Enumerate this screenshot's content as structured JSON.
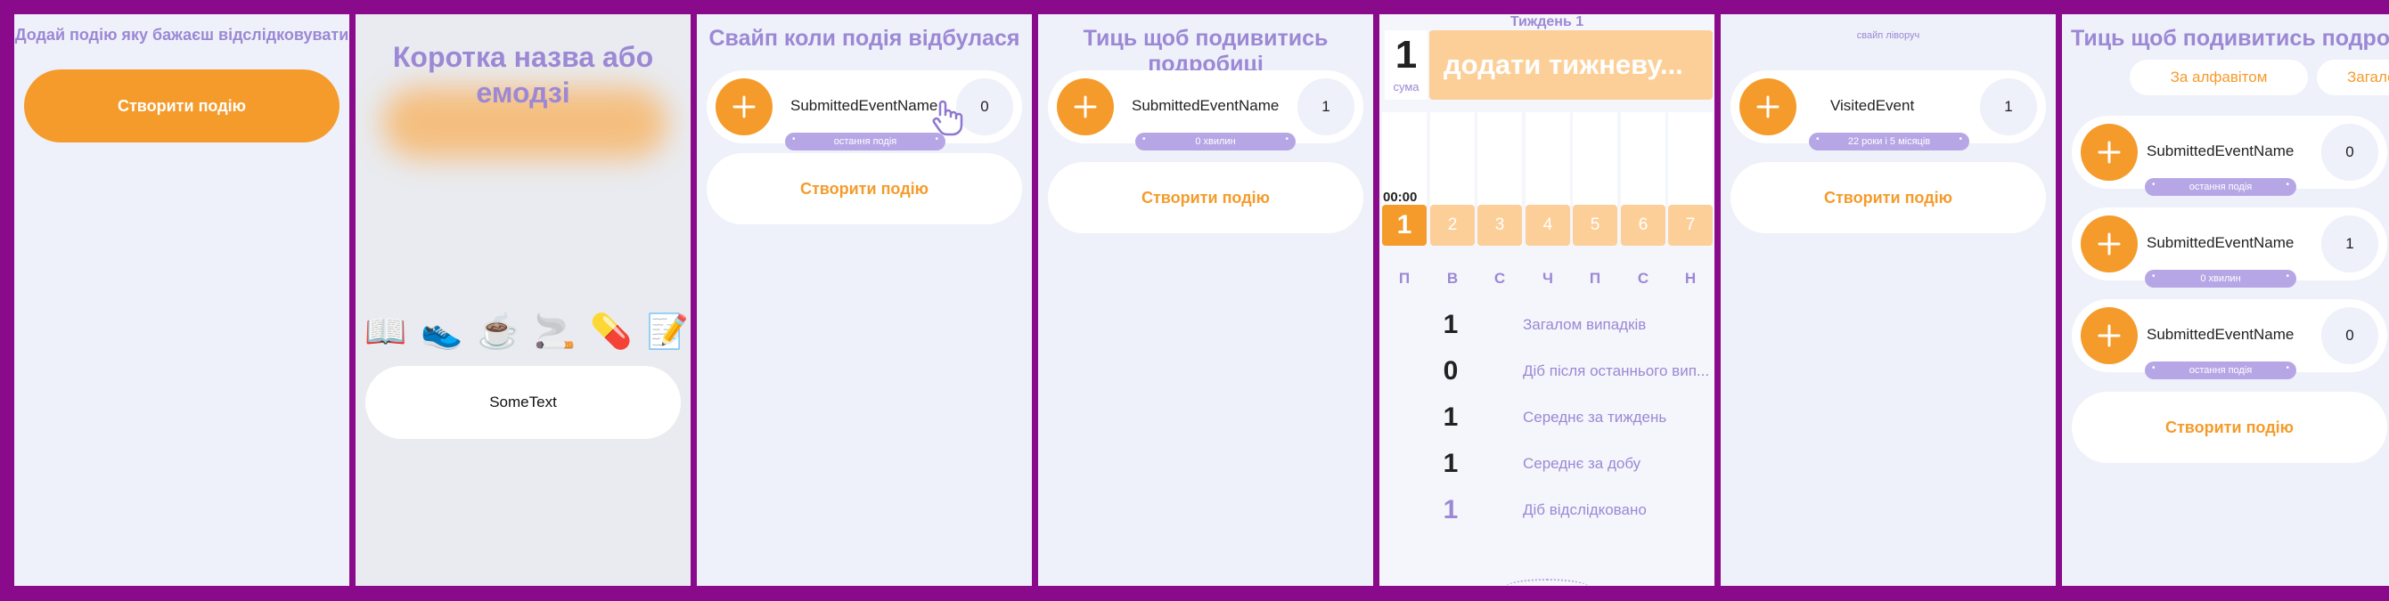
{
  "screens": {
    "s1": {
      "hint": "Додай подію яку бажаєш відслідковувати",
      "button": "Створити подію"
    },
    "s2": {
      "title": "Коротка назва або емодзі",
      "emojis": [
        "📖",
        "👟",
        "☕",
        "🚬",
        "💊",
        "📝"
      ],
      "field_value": "SomeText"
    },
    "s3": {
      "hint": "Свайп коли подія відбулася",
      "event": {
        "name": "SubmittedEventName",
        "count": "0",
        "pill": "остання подія"
      },
      "create_button": "Створити подію"
    },
    "s4": {
      "hint": "Тиць щоб подивитись подробиці",
      "event": {
        "name": "SubmittedEventName",
        "count": "1",
        "pill": "0 хвилин"
      },
      "create_button": "Створити подію"
    },
    "s5": {
      "week_title": "Тиждень 1",
      "sum_value": "1",
      "sum_label": "сума",
      "week_placeholder": "додати тижневу...",
      "time": "00:00",
      "day_numbers": [
        "1",
        "2",
        "3",
        "4",
        "5",
        "6",
        "7"
      ],
      "day_names": [
        "П",
        "В",
        "С",
        "Ч",
        "П",
        "С",
        "Н"
      ],
      "stats": [
        {
          "value": "1",
          "label": "Загалом випадків"
        },
        {
          "value": "0",
          "label": "Діб після останнього вип..."
        },
        {
          "value": "1",
          "label": "Середнє за тиждень"
        },
        {
          "value": "1",
          "label": "Середнє за добу"
        },
        {
          "value": "1",
          "label": "Діб відслідковано"
        }
      ]
    },
    "s6": {
      "hint": "свайп ліворуч",
      "event": {
        "name": "VisitedEvent",
        "count": "1",
        "pill": "22 роки і 5 місяців"
      },
      "create_button": "Створити подію"
    },
    "s7": {
      "hint": "Тиць щоб подивитись подробиці",
      "sort_tabs": [
        "За алфавітом",
        "Загалом"
      ],
      "events": [
        {
          "name": "SubmittedEventName",
          "count": "0",
          "pill": "остання подія"
        },
        {
          "name": "SubmittedEventName",
          "count": "1",
          "pill": "0 хвилин"
        },
        {
          "name": "SubmittedEventName",
          "count": "0",
          "pill": "остання подія"
        }
      ],
      "create_button": "Створити подію"
    }
  },
  "colors": {
    "frame": "#8a0a8c",
    "accent": "#f59b2b",
    "accent_light": "#fdcf98",
    "lavender": "#9c88d4",
    "screen_bg": "#eef1fa"
  },
  "icons": {
    "plus": "plus-icon",
    "cursor": "tap-hand-icon"
  }
}
